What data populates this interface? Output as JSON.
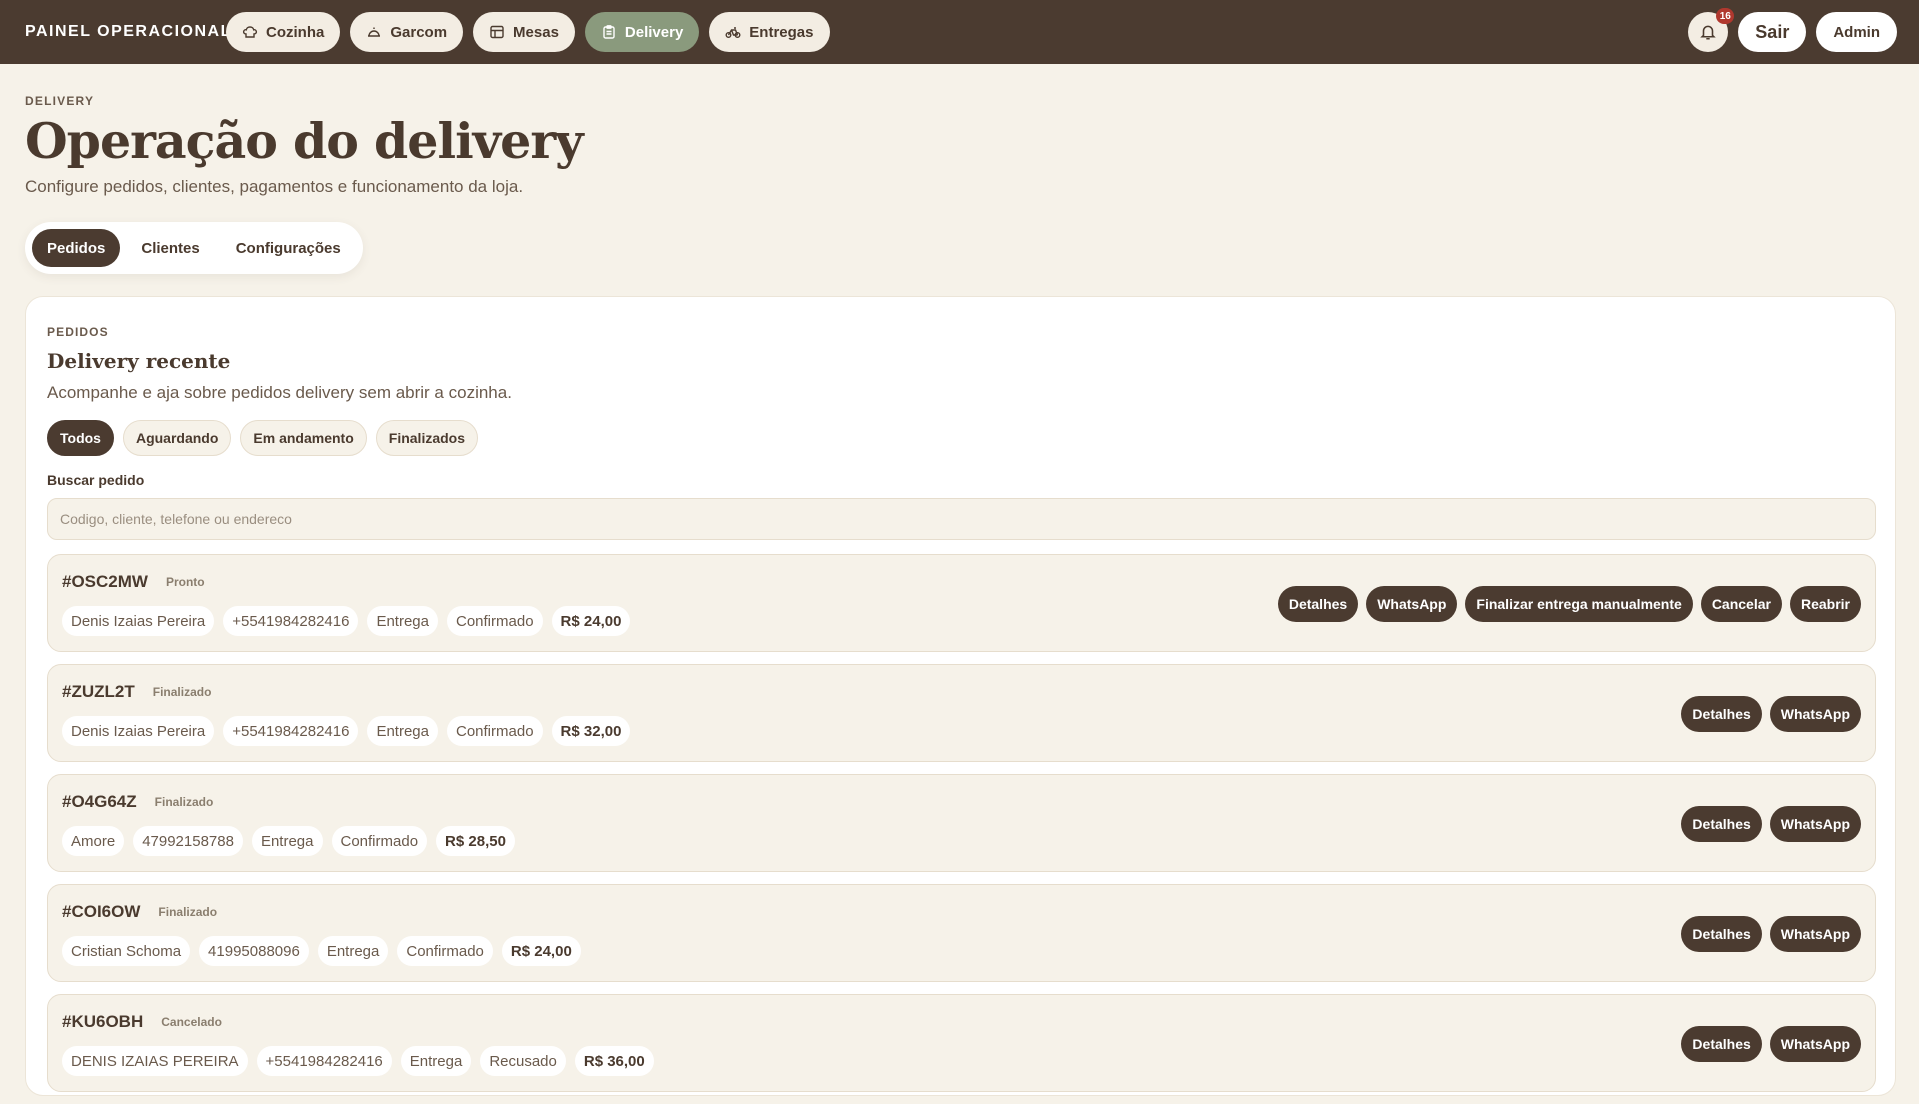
{
  "topbar": {
    "brand": "PAINEL OPERACIONAL",
    "nav": [
      {
        "label": "Cozinha",
        "icon": "chef-hat-icon",
        "active": false
      },
      {
        "label": "Garcom",
        "icon": "cloche-icon",
        "active": false
      },
      {
        "label": "Mesas",
        "icon": "table-icon",
        "active": false
      },
      {
        "label": "Delivery",
        "icon": "clipboard-icon",
        "active": true
      },
      {
        "label": "Entregas",
        "icon": "bike-icon",
        "active": false
      }
    ],
    "notifications_count": "16",
    "logout_label": "Sair",
    "user_label": "Admin"
  },
  "header": {
    "eyebrow": "DELIVERY",
    "title": "Operação do delivery",
    "subtitle": "Configure pedidos, clientes, pagamentos e funcionamento da loja."
  },
  "tabs": [
    {
      "label": "Pedidos",
      "active": true
    },
    {
      "label": "Clientes",
      "active": false
    },
    {
      "label": "Configurações",
      "active": false
    }
  ],
  "panel": {
    "eyebrow": "PEDIDOS",
    "title": "Delivery recente",
    "subtitle": "Acompanhe e aja sobre pedidos delivery sem abrir a cozinha.",
    "filters": [
      {
        "label": "Todos",
        "active": true
      },
      {
        "label": "Aguardando",
        "active": false
      },
      {
        "label": "Em andamento",
        "active": false
      },
      {
        "label": "Finalizados",
        "active": false
      }
    ],
    "search_label": "Buscar pedido",
    "search_placeholder": "Codigo, cliente, telefone ou endereco"
  },
  "orders": [
    {
      "code": "#OSC2MW",
      "status": "Pronto",
      "customer": "Denis Izaias Pereira",
      "phone": "+5541984282416",
      "type": "Entrega",
      "payment": "Confirmado",
      "total": "R$ 24,00",
      "actions": [
        "Detalhes",
        "WhatsApp",
        "Finalizar entrega manualmente",
        "Cancelar",
        "Reabrir"
      ]
    },
    {
      "code": "#ZUZL2T",
      "status": "Finalizado",
      "customer": "Denis Izaias Pereira",
      "phone": "+5541984282416",
      "type": "Entrega",
      "payment": "Confirmado",
      "total": "R$ 32,00",
      "actions": [
        "Detalhes",
        "WhatsApp"
      ]
    },
    {
      "code": "#O4G64Z",
      "status": "Finalizado",
      "customer": "Amore",
      "phone": "47992158788",
      "type": "Entrega",
      "payment": "Confirmado",
      "total": "R$ 28,50",
      "actions": [
        "Detalhes",
        "WhatsApp"
      ]
    },
    {
      "code": "#COI6OW",
      "status": "Finalizado",
      "customer": "Cristian Schoma",
      "phone": "41995088096",
      "type": "Entrega",
      "payment": "Confirmado",
      "total": "R$ 24,00",
      "actions": [
        "Detalhes",
        "WhatsApp"
      ]
    },
    {
      "code": "#KU6OBH",
      "status": "Cancelado",
      "customer": "DENIS IZAIAS PEREIRA",
      "phone": "+5541984282416",
      "type": "Entrega",
      "payment": "Recusado",
      "total": "R$ 36,00",
      "actions": [
        "Detalhes",
        "WhatsApp"
      ]
    }
  ],
  "colors": {
    "topbar_bg": "#4b3b30",
    "page_bg": "#f6f2e9",
    "active_nav": "#8a9a7d",
    "dark_button": "#4b3b30",
    "badge": "#b0382e"
  }
}
